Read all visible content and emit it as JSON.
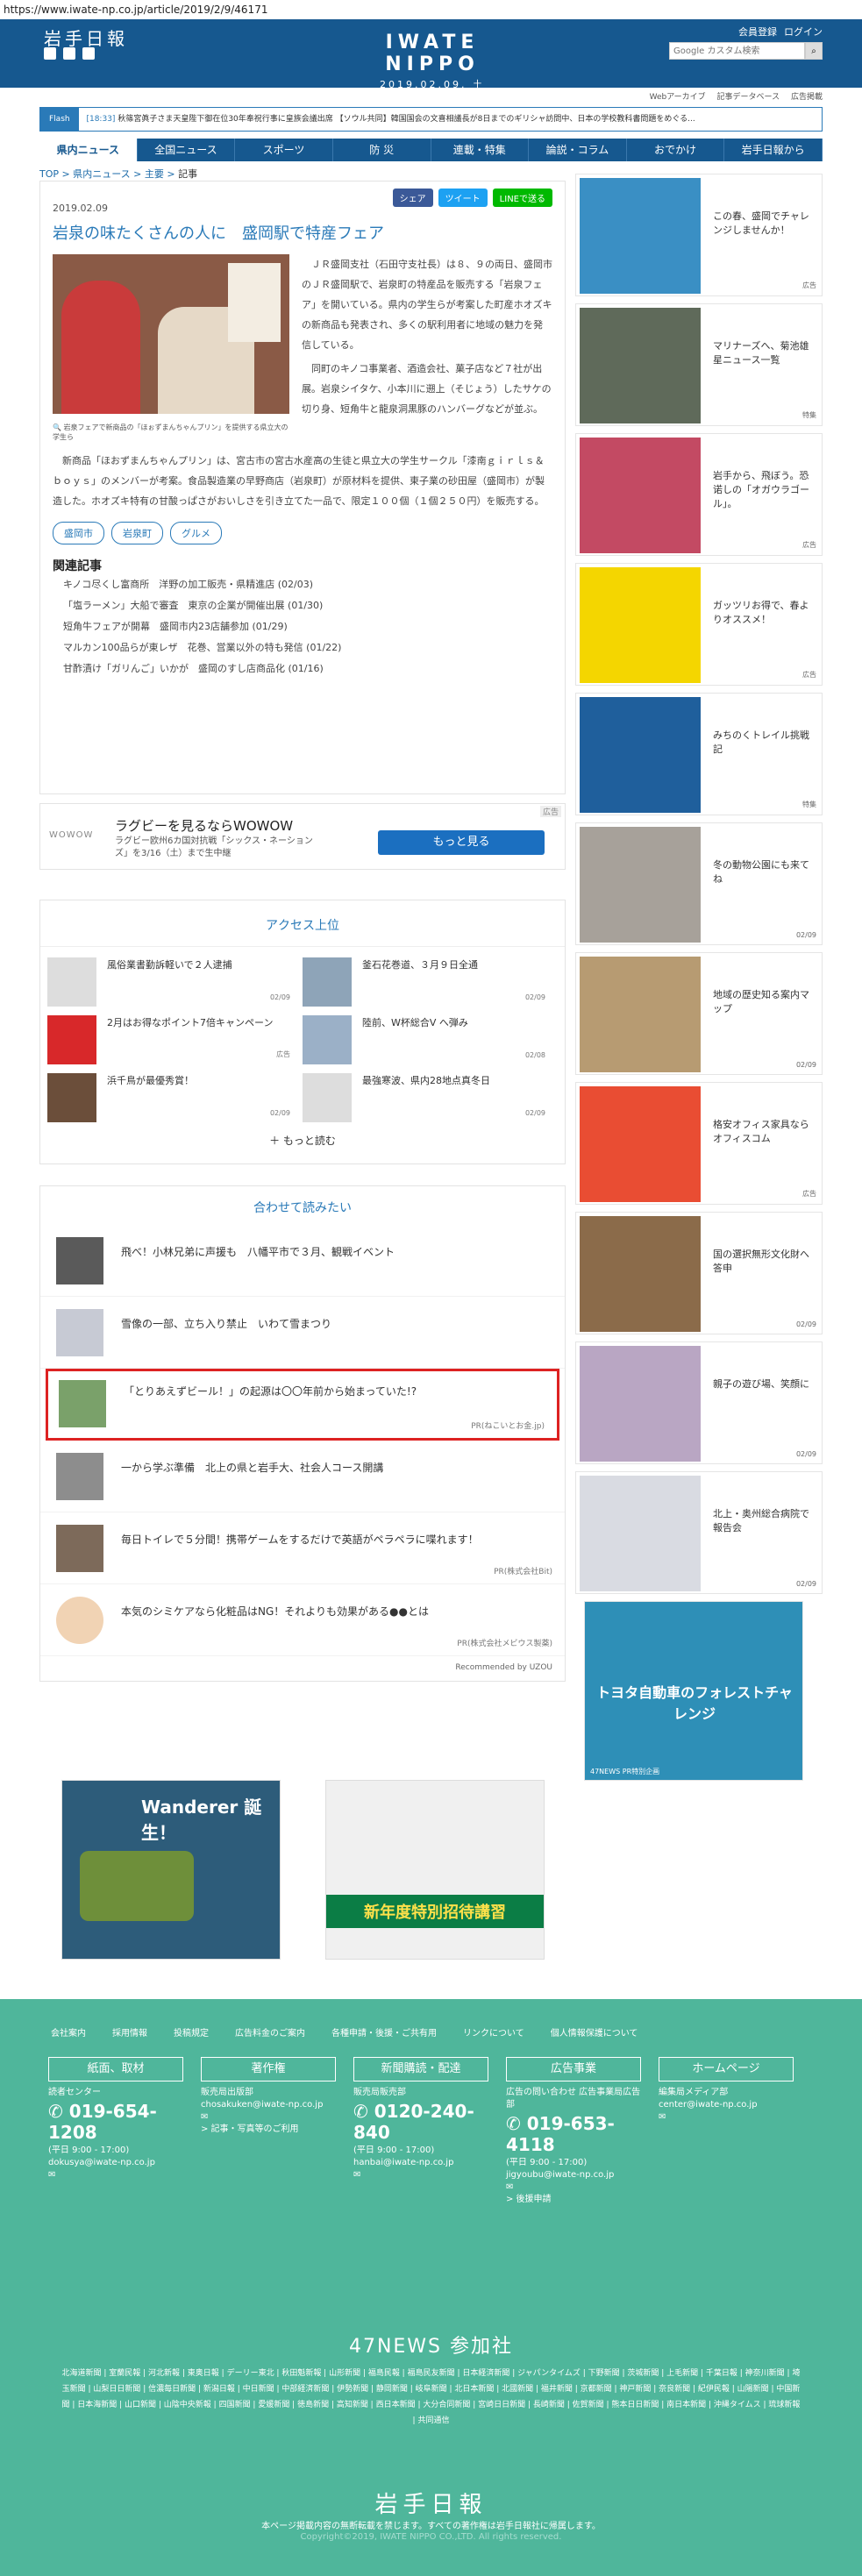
{
  "browser": {
    "url": "https://www.iwate-np.co.jp/article/2019/2/9/46171"
  },
  "header": {
    "logo_jp": "岩手日報",
    "logo_en": "IWATE NIPPO",
    "date": "2019.02.09. 土",
    "links": [
      "会員登録",
      "ログイン"
    ],
    "search_placeholder": "Google カスタム検索",
    "social": [
      "twitter-icon",
      "facebook-icon",
      "instagram-icon"
    ]
  },
  "subnav": [
    "Webアーカイブ",
    "記事データベース",
    "広告掲載"
  ],
  "flash": {
    "label": "Flash",
    "time": "[18:33]",
    "text": "秋篠宮眞子さま天皇陛下御在位30年奉祝行事に皇族会議出席   【ソウル共同】韓国国会の文喜相議長が8日までのギリシャ訪問中、日本の学校教科書問題をめぐる..."
  },
  "gnav": [
    "県内ニュース",
    "全国ニュース",
    "スポーツ",
    "防 災",
    "連載・特集",
    "論説・コラム",
    "おでかけ",
    "岩手日報から"
  ],
  "breadcrumb": {
    "items": [
      "TOP",
      "県内ニュース",
      "主要"
    ],
    "current": "記事"
  },
  "article": {
    "share": {
      "facebook": "シェア",
      "twitter": "ツイート",
      "line": "LINEで送る"
    },
    "date": "2019.02.09",
    "title": "岩泉の味たくさんの人に　盛岡駅で特産フェア",
    "caption": "岩泉フェアで新商品の「ほぉずまんちゃんプリン」を提供する県立大の学生ら",
    "paragraphs": [
      "ＪＲ盛岡支社（石田守支社長）は８、９の両日、盛岡市のＪＲ盛岡駅で、岩泉町の特産品を販売する「岩泉フェア」を開いている。県内の学生らが考案した町産ホオズキの新商品も発表され、多くの駅利用者に地域の魅力を発信している。",
      "同町のキノコ事業者、酒造会社、菓子店など７社が出展。岩泉シイタケ、小本川に遡上（そじょう）したサケの切り身、短角牛と龍泉洞黒豚のハンバーグなどが並ぶ。",
      "新商品「ほおずまんちゃんプリン」は、宮古市の宮古水産高の生徒と県立大の学生サークル「漆南ｇｉｒｌｓ＆ｂｏｙｓ」のメンバーが考案。食品製造業の早野商店（岩泉町）が原材料を提供、東子業の砂田屋（盛岡市）が製造した。ホオズキ特有の甘酸っぱさがおいしさを引き立てた一品で、限定１００個（１個２５０円）を販売する。"
    ],
    "tags": [
      "盛岡市",
      "岩泉町",
      "グルメ"
    ],
    "related_title": "関連記事",
    "related": [
      "キノコ尽くし富商所　洋野の加工販売・県精進店 (02/03)",
      "「塩ラーメン」大船で審査　東京の企業が開催出展 (01/30)",
      "短角牛フェアが開幕　盛岡市内23店舗参加 (01/29)",
      "マルカン100品らが東レザ　花巻、営業以外の特も発信 (01/22)",
      "甘酢漬け「ガリんご」いかが　盛岡のすし店商品化 (01/16)"
    ]
  },
  "ad": {
    "tag": "広告",
    "brand": "WOWOW",
    "headline": "ラグビーを見るならWOWOW",
    "sub": "ラグビー欧州6カ国対抗戦「シックス・ネーションズ」を3/16（土）まで生中継",
    "button": "もっと見る"
  },
  "ranking": {
    "title": "アクセス上位",
    "items": [
      {
        "title": "風俗業書勤訴軽いで２人逮捕",
        "date": "02/09"
      },
      {
        "title": "釜石花巻道、３月９日全通",
        "date": "02/09"
      },
      {
        "title": "2月はお得なポイント7倍キャンペーン",
        "date": "広告"
      },
      {
        "title": "陸前、W杯総合V へ弾み",
        "date": "02/08"
      },
      {
        "title": "浜千鳥が最優秀賞！",
        "date": "02/09"
      },
      {
        "title": "最強寒波、県内28地点真冬日",
        "date": "02/09"
      }
    ],
    "more": "もっと読む"
  },
  "recommend": {
    "title": "合わせて読みたい",
    "items": [
      {
        "title": "飛べ！小林兄弟に声援も　八幡平市で３月、観戦イベント",
        "pr": ""
      },
      {
        "title": "雪像の一部、立ち入り禁止　いわて雪まつり",
        "pr": ""
      },
      {
        "title": "「とりあえずビール！」の起源は〇〇年前から始まっていた!?",
        "pr": "PR(ねこいとお金.jp)"
      },
      {
        "title": "一から学ぶ準備　北上の県と岩手大、社会人コース開講",
        "pr": ""
      },
      {
        "title": "毎日トイレで５分間！携帯ゲームをするだけで英語がペラペラに喋れます！",
        "pr": "PR(株式会社Bit)"
      },
      {
        "title": "本気のシミケアなら化粧品はNG！それよりも効果がある●●とは",
        "pr": "PR(株式会社メビウス製薬)"
      }
    ],
    "footer": "Recommended by UZOU"
  },
  "side": [
    {
      "text": "この春、盛岡でチャレンジしませんか！",
      "tag": "広告"
    },
    {
      "text": "マリナーズへ、菊池雄星ニュース一覧",
      "tag": "特集"
    },
    {
      "text": "岩手から、飛ぼう。恐诺しの「オガウラゴール」。",
      "tag": "広告"
    },
    {
      "text": "ガッツリお得で、春よりオススメ！",
      "tag": "広告"
    },
    {
      "text": "みちのくトレイル挑戦記",
      "tag": "特集"
    },
    {
      "text": "冬の動物公園にも来てね",
      "tag": "02/09"
    },
    {
      "text": "地域の歴史知る案内マップ",
      "tag": "02/09"
    },
    {
      "text": "格安オフィス家具ならオフィスコム",
      "tag": "広告"
    },
    {
      "text": "国の選択無形文化財へ答申",
      "tag": "02/09"
    },
    {
      "text": "親子の遊び場、笑顔に",
      "tag": "02/09"
    },
    {
      "text": "北上・奥州総合病院で報告会",
      "tag": "02/09"
    }
  ],
  "side_big": {
    "title": "トヨタ自動車のフォレストチャレンジ",
    "tag": "47NEWS PR特別企画"
  },
  "bottom_ads": {
    "suzuki": "Wanderer 誕生！",
    "juku": "新年度特別招待講習"
  },
  "footer": {
    "links": [
      "会社案内",
      "採用情報",
      "投稿規定",
      "広告料金のご案内",
      "各種申請・後援・ご共有用",
      "リンクについて",
      "個人情報保護について"
    ],
    "cols": [
      {
        "head": "紙面、取材",
        "label": "読者センター",
        "tel": "019-654-1208",
        "hours": "(平日 9:00 - 17:00)",
        "mail": "dokusya@iwate-np.co.jp",
        "extra": ""
      },
      {
        "head": "著作権",
        "label": "販売局出版部",
        "tel": "",
        "hours": "",
        "mail": "chosakuken@iwate-np.co.jp",
        "extra": "> 記事・写真等のご利用"
      },
      {
        "head": "新聞購読・配達",
        "label": "販売局販売部",
        "tel": "0120-240-840",
        "hours": "(平日 9:00 - 17:00)",
        "mail": "hanbai@iwate-np.co.jp",
        "extra": ""
      },
      {
        "head": "広告事業",
        "label": "広告の問い合わせ 広告事業局広告部",
        "tel": "019-653-4118",
        "hours": "(平日 9:00 - 17:00)",
        "mail": "jigyoubu@iwate-np.co.jp",
        "extra": "> 後援申請"
      },
      {
        "head": "ホームページ",
        "label": "編集局メディア部",
        "tel": "",
        "hours": "",
        "mail": "center@iwate-np.co.jp",
        "extra": ""
      }
    ],
    "n47_title": "47NEWS 参加社",
    "n47_list": "北海道新聞 | 室蘭民報 | 河北新報 | 東奥日報 | デーリー東北 | 秋田魁新報 | 山形新聞 | 福島民報 | 福島民友新聞 | 日本経済新聞 | ジャパンタイムズ | 下野新聞 | 茨城新聞 | 上毛新聞 | 千葉日報 | 神奈川新聞 | 埼玉新聞 | 山梨日日新聞 | 信濃毎日新聞 | 新潟日報 | 中日新聞 | 中部経済新聞 | 伊勢新聞 | 静岡新聞 | 岐阜新聞 | 北日本新聞 | 北國新聞 | 福井新聞 | 京都新聞 | 神戸新聞 | 奈良新聞 | 紀伊民報 | 山陽新聞 | 中国新聞 | 日本海新聞 | 山口新聞 | 山陰中央新報 | 四国新聞 | 愛媛新聞 | 徳島新聞 | 高知新聞 | 西日本新聞 | 大分合同新聞 | 宮崎日日新聞 | 長崎新聞 | 佐賀新聞 | 熊本日日新聞 | 南日本新聞 | 沖縄タイムス | 琉球新報 | 共同通信",
    "logo": "岩手日報",
    "note": "本ページ掲載内容の無断転載を禁じます。すべての著作権は岩手日報社に帰属します。",
    "copy": "Copyright©2019, IWATE NIPPO CO.,LTD. All rights reserved."
  }
}
